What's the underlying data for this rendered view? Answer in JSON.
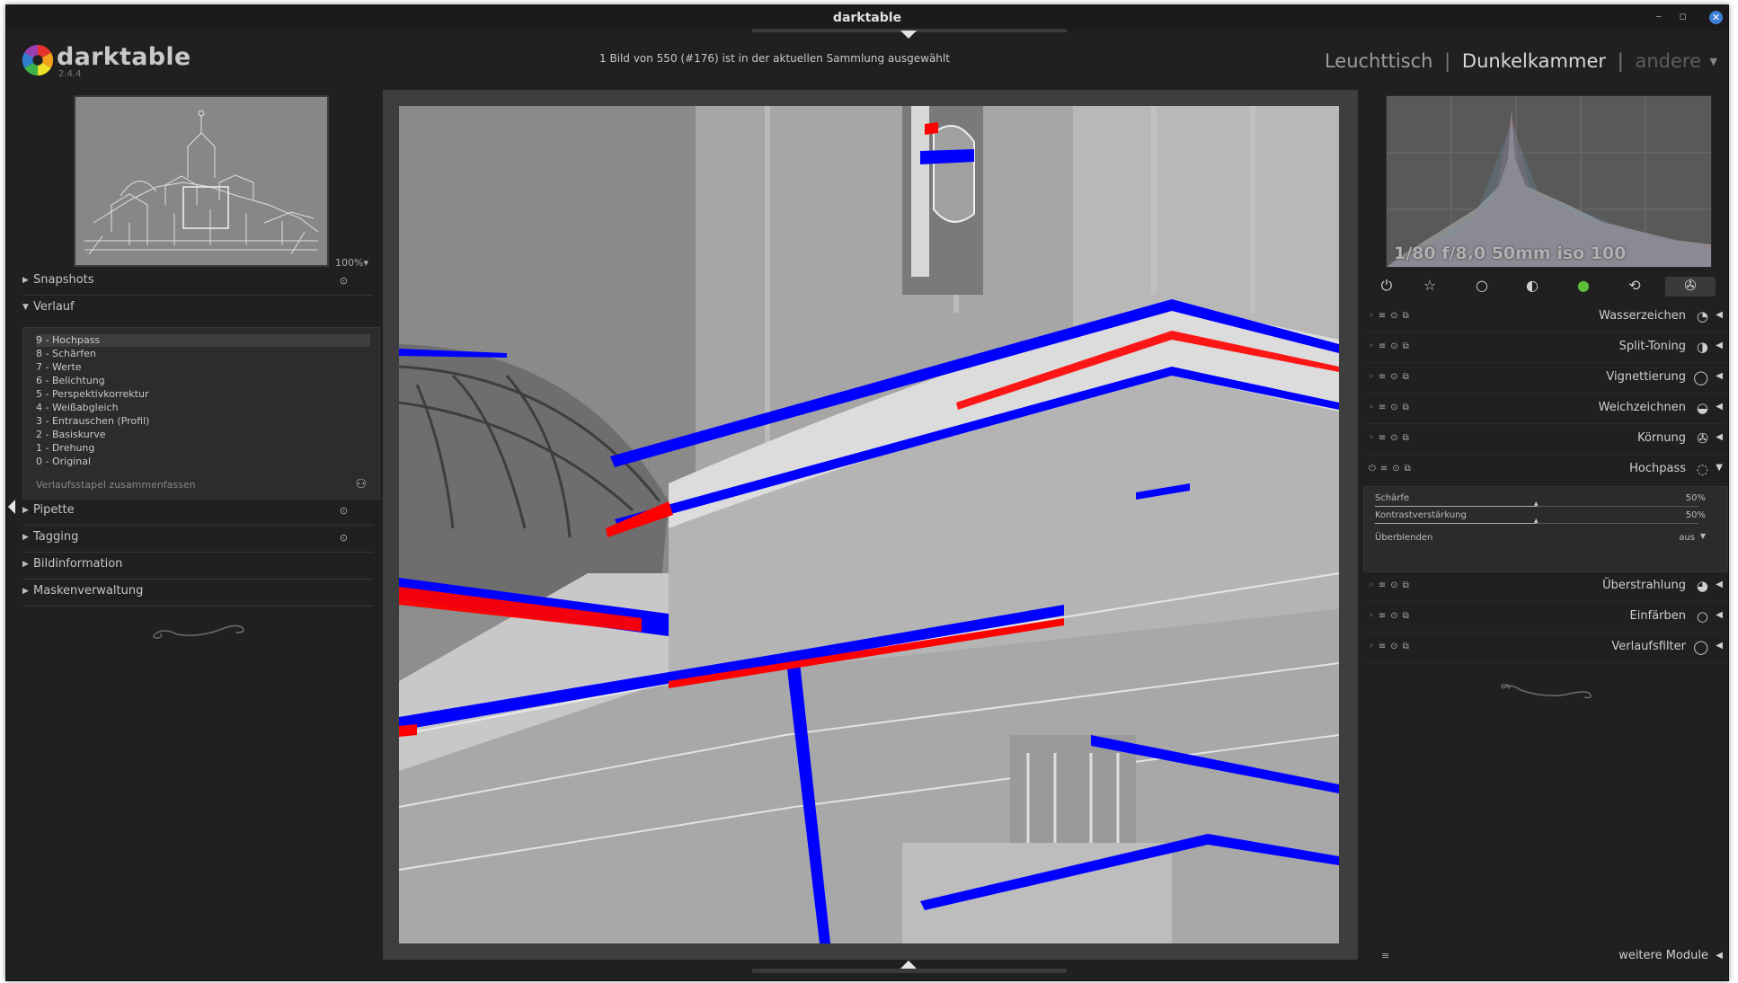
{
  "window": {
    "title": "darktable",
    "minimize": "–",
    "restore": "▫",
    "close": "✕"
  },
  "header": {
    "app_name": "darktable",
    "app_version": "2.4.4",
    "info": "1 Bild von 550 (#176) ist in der aktuellen Sammlung ausgewählt",
    "views": {
      "lighttable": "Leuchttisch",
      "darkroom": "Dunkelkammer",
      "other": "andere",
      "separator": "|"
    }
  },
  "left": {
    "zoom": "100%▾",
    "sections": {
      "snapshots": "Snapshots",
      "history": "Verlauf",
      "picker": "Pipette",
      "tagging": "Tagging",
      "image_info": "Bildinformation",
      "masks": "Maskenverwaltung"
    },
    "history_items": [
      "9 - Hochpass",
      "8 - Schärfen",
      "7 - Werte",
      "6 - Belichtung",
      "5 - Perspektivkorrektur",
      "4 - Weißabgleich",
      "3 - Entrauschen (Profil)",
      "2 - Basiskurve",
      "1 - Drehung",
      "0 - Original"
    ],
    "compress_label": "Verlaufsstapel zusammenfassen"
  },
  "right": {
    "exif": "1/80 f/8,0 50mm iso 100",
    "modules": [
      "Wasserzeichen",
      "Split-Toning",
      "Vignettierung",
      "Weichzeichnen",
      "Körnung",
      "Hochpass",
      "Überstrahlung",
      "Einfärben",
      "Verlaufsfilter"
    ],
    "highpass": {
      "sharpness_label": "Schärfe",
      "sharpness_value": "50%",
      "contrast_label": "Kontrastverstärkung",
      "contrast_value": "50%",
      "blend_label": "Überblenden",
      "blend_value": "aus"
    },
    "more_modules": "weitere Module"
  },
  "colors": {
    "accent_blue": "#0000ff",
    "accent_red": "#ff0000",
    "close_button": "#3d7fd6"
  }
}
